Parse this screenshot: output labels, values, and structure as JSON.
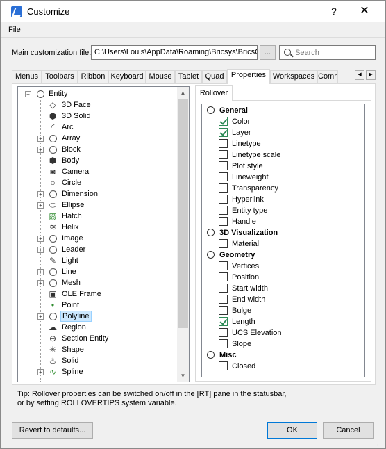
{
  "window": {
    "title": "Customize",
    "help_glyph": "?",
    "close_glyph": "✕"
  },
  "menu": {
    "file": "File"
  },
  "main_file": {
    "label": "Main customization file:",
    "value": "C:\\Users\\Louis\\AppData\\Roaming\\Bricsys\\BricsCAD",
    "browse_label": "...",
    "search_placeholder": "Search"
  },
  "tabs": [
    {
      "label": "Menus",
      "active": false
    },
    {
      "label": "Toolbars",
      "active": false
    },
    {
      "label": "Ribbon",
      "active": false
    },
    {
      "label": "Keyboard",
      "active": false
    },
    {
      "label": "Mouse",
      "active": false
    },
    {
      "label": "Tablet",
      "active": false
    },
    {
      "label": "Quad",
      "active": false
    },
    {
      "label": "Properties",
      "active": true
    },
    {
      "label": "Workspaces",
      "active": false
    },
    {
      "label": "Comm",
      "active": false
    }
  ],
  "tree": {
    "root": "Entity",
    "items": [
      {
        "label": "3D Face",
        "icon": "3d-face-icon",
        "expandable": false,
        "selected": false
      },
      {
        "label": "3D Solid",
        "icon": "3d-solid-icon",
        "expandable": false,
        "selected": false
      },
      {
        "label": "Arc",
        "icon": "arc-icon",
        "expandable": false,
        "selected": false
      },
      {
        "label": "Array",
        "icon": "circle-icon",
        "expandable": true,
        "selected": false
      },
      {
        "label": "Block",
        "icon": "circle-icon",
        "expandable": true,
        "selected": false
      },
      {
        "label": "Body",
        "icon": "body-icon",
        "expandable": false,
        "selected": false
      },
      {
        "label": "Camera",
        "icon": "camera-icon",
        "expandable": false,
        "selected": false
      },
      {
        "label": "Circle",
        "icon": "circle-entity-icon",
        "expandable": false,
        "selected": false
      },
      {
        "label": "Dimension",
        "icon": "circle-icon",
        "expandable": true,
        "selected": false
      },
      {
        "label": "Ellipse",
        "icon": "ellipse-icon",
        "expandable": true,
        "selected": false
      },
      {
        "label": "Hatch",
        "icon": "hatch-icon",
        "expandable": false,
        "selected": false
      },
      {
        "label": "Helix",
        "icon": "helix-icon",
        "expandable": false,
        "selected": false
      },
      {
        "label": "Image",
        "icon": "circle-icon",
        "expandable": true,
        "selected": false
      },
      {
        "label": "Leader",
        "icon": "circle-icon",
        "expandable": true,
        "selected": false
      },
      {
        "label": "Light",
        "icon": "light-icon",
        "expandable": false,
        "selected": false
      },
      {
        "label": "Line",
        "icon": "circle-icon",
        "expandable": true,
        "selected": false
      },
      {
        "label": "Mesh",
        "icon": "circle-icon",
        "expandable": true,
        "selected": false
      },
      {
        "label": "OLE Frame",
        "icon": "ole-frame-icon",
        "expandable": false,
        "selected": false
      },
      {
        "label": "Point",
        "icon": "point-icon",
        "expandable": false,
        "selected": false
      },
      {
        "label": "Polyline",
        "icon": "circle-icon",
        "expandable": true,
        "selected": true
      },
      {
        "label": "Region",
        "icon": "region-icon",
        "expandable": false,
        "selected": false
      },
      {
        "label": "Section Entity",
        "icon": "section-icon",
        "expandable": false,
        "selected": false
      },
      {
        "label": "Shape",
        "icon": "shape-icon",
        "expandable": false,
        "selected": false
      },
      {
        "label": "Solid",
        "icon": "solid-icon",
        "expandable": false,
        "selected": false
      },
      {
        "label": "Spline",
        "icon": "spline-icon",
        "expandable": true,
        "selected": false
      }
    ]
  },
  "rollover": {
    "tab_label": "Rollover",
    "groups": [
      {
        "name": "General",
        "items": [
          {
            "label": "Color",
            "checked": true
          },
          {
            "label": "Layer",
            "checked": true
          },
          {
            "label": "Linetype",
            "checked": false
          },
          {
            "label": "Linetype scale",
            "checked": false
          },
          {
            "label": "Plot style",
            "checked": false
          },
          {
            "label": "Lineweight",
            "checked": false
          },
          {
            "label": "Transparency",
            "checked": false
          },
          {
            "label": "Hyperlink",
            "checked": false
          },
          {
            "label": "Entity type",
            "checked": false
          },
          {
            "label": "Handle",
            "checked": false
          }
        ]
      },
      {
        "name": "3D Visualization",
        "items": [
          {
            "label": "Material",
            "checked": false
          }
        ]
      },
      {
        "name": "Geometry",
        "items": [
          {
            "label": "Vertices",
            "checked": false
          },
          {
            "label": "Position",
            "checked": false
          },
          {
            "label": "Start width",
            "checked": false
          },
          {
            "label": "End width",
            "checked": false
          },
          {
            "label": "Bulge",
            "checked": false
          },
          {
            "label": "Length",
            "checked": true
          },
          {
            "label": "UCS Elevation",
            "checked": false
          },
          {
            "label": "Slope",
            "checked": false
          }
        ]
      },
      {
        "name": "Misc",
        "items": [
          {
            "label": "Closed",
            "checked": false
          }
        ]
      }
    ]
  },
  "tip": {
    "line1": "Tip: Rollover properties can be switched on/off in the [RT] pane in the statusbar,",
    "line2": "or by setting ROLLOVERTIPS system variable."
  },
  "buttons": {
    "revert": "Revert to defaults...",
    "ok": "OK",
    "cancel": "Cancel"
  },
  "colors": {
    "check": "#2e8b57",
    "selection": "#cce8ff",
    "default_button_border": "#0078d7"
  }
}
